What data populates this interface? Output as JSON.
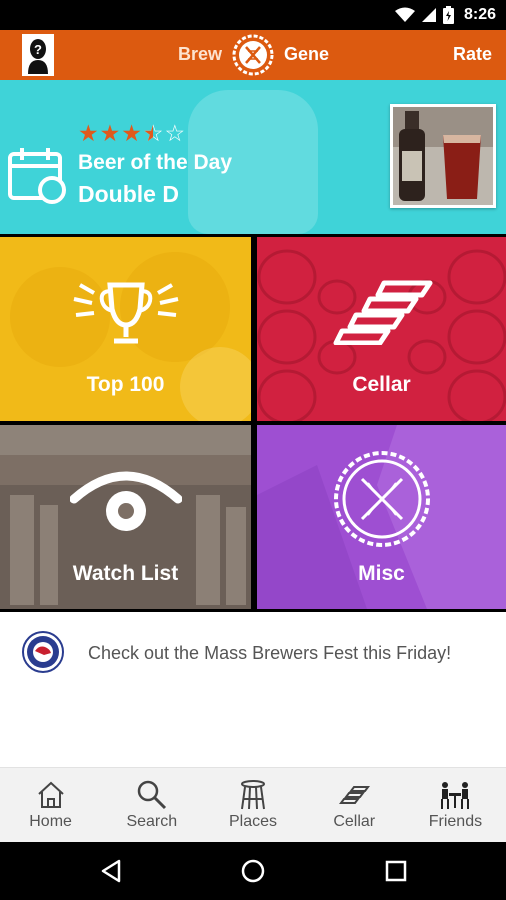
{
  "status_bar": {
    "time": "8:26",
    "icons": [
      "wifi-icon",
      "signal-icon",
      "battery-icon"
    ]
  },
  "header": {
    "brand_left": "Brew",
    "brand_right": "Gene",
    "rate_label": "Rate",
    "colors": {
      "bar": "#dc5a10"
    }
  },
  "beer_of_the_day": {
    "rating": 3.5,
    "max_rating": 5,
    "label": "Beer of the Day",
    "name": "Double D",
    "color": "#3fd3d8"
  },
  "tiles": [
    {
      "label": "Top 100",
      "icon": "trophy-icon",
      "color": "#f1ba18"
    },
    {
      "label": "Cellar",
      "icon": "cellar-stairs-icon",
      "color": "#d12140"
    },
    {
      "label": "Watch List",
      "icon": "eye-icon",
      "color": "#7d6f65"
    },
    {
      "label": "Misc",
      "icon": "dna-badge-icon",
      "color": "#9e4fd2"
    }
  ],
  "news": {
    "text": "Check out the Mass Brewers Fest this Friday!"
  },
  "bottom_nav": [
    {
      "label": "Home",
      "icon": "home-icon"
    },
    {
      "label": "Search",
      "icon": "search-icon"
    },
    {
      "label": "Places",
      "icon": "stool-icon"
    },
    {
      "label": "Cellar",
      "icon": "cellar-icon"
    },
    {
      "label": "Friends",
      "icon": "friends-icon"
    }
  ],
  "system_nav": [
    "back-icon",
    "home-circle-icon",
    "recents-icon"
  ]
}
